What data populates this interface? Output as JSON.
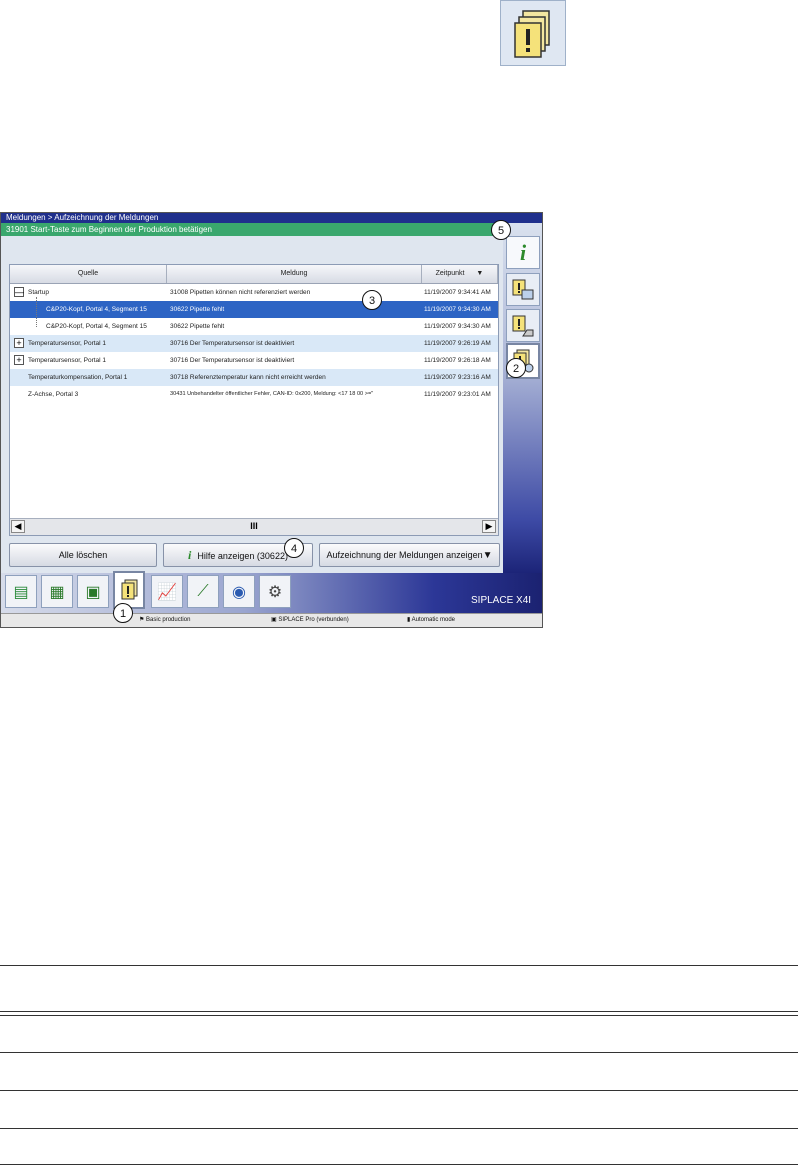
{
  "window": {
    "breadcrumb": "Meldungen > Aufzeichnung der Meldungen",
    "message_bar": "31901 Start-Taste zum Beginnen der Produktion betätigen"
  },
  "table": {
    "headers": [
      "Quelle",
      "Meldung",
      "Zeitpunkt"
    ],
    "rows": [
      {
        "source": "Startup",
        "message": "31008 Pipetten können nicht referenziert werden",
        "time": "11/19/2007 9:34:41 AM",
        "toggle": "—"
      },
      {
        "source": "C&P20-Kopf, Portal 4, Segment 15",
        "message": "30622 Pipette fehlt",
        "time": "11/19/2007 9:34:30 AM"
      },
      {
        "source": "C&P20-Kopf, Portal 4, Segment 15",
        "message": "30622 Pipette fehlt",
        "time": "11/19/2007 9:34:30 AM"
      },
      {
        "source": "Temperatursensor, Portal 1",
        "message": "30716 Der Temperatursensor ist deaktiviert",
        "time": "11/19/2007 9:26:19 AM",
        "toggle": "+"
      },
      {
        "source": "Temperatursensor, Portal 1",
        "message": "30716 Der Temperatursensor ist deaktiviert",
        "time": "11/19/2007 9:26:18 AM",
        "toggle": "+"
      },
      {
        "source": "Temperaturkompensation, Portal 1",
        "message": "30718 Referenztemperatur kann nicht erreicht werden",
        "time": "11/19/2007 9:23:16 AM"
      },
      {
        "source": "Z-Achse, Portal 3",
        "message": "30431 Unbehandelter öffentlicher Fehler, CAN-ID: 0x200, Meldung: <17 18 00 >=\"",
        "time": "11/19/2007 9:23:01 AM"
      }
    ]
  },
  "scrollbar": {
    "left": "◀",
    "thumb": "III",
    "right": "▶"
  },
  "buttons": {
    "clear_all": "Alle löschen",
    "help": "Hilfe anzeigen (30622)",
    "show_log": "Aufzeichnung der Meldungen anzeigen"
  },
  "brand": "SIPLACE X4I",
  "status": {
    "mode": "Basic production",
    "connection": "SIPLACE Pro (verbunden)",
    "auto": "Automatic mode"
  },
  "callouts": [
    "1",
    "2",
    "3",
    "4",
    "5"
  ],
  "icons": {
    "top": "message-log-icon",
    "side": [
      "info-icon",
      "message-screen-icon",
      "message-hand-icon",
      "message-log-icon"
    ],
    "tabs": [
      "stack-icon",
      "grid-icon",
      "board-icon",
      "message-icon",
      "chart-icon",
      "nozzle-icon",
      "camera-icon",
      "settings-icon"
    ]
  },
  "colors": {
    "title_bar": "#1f2f8c",
    "message_bar": "#3aa76d",
    "selected_row": "#2d64c4",
    "alt_row": "#d9e8f7"
  }
}
